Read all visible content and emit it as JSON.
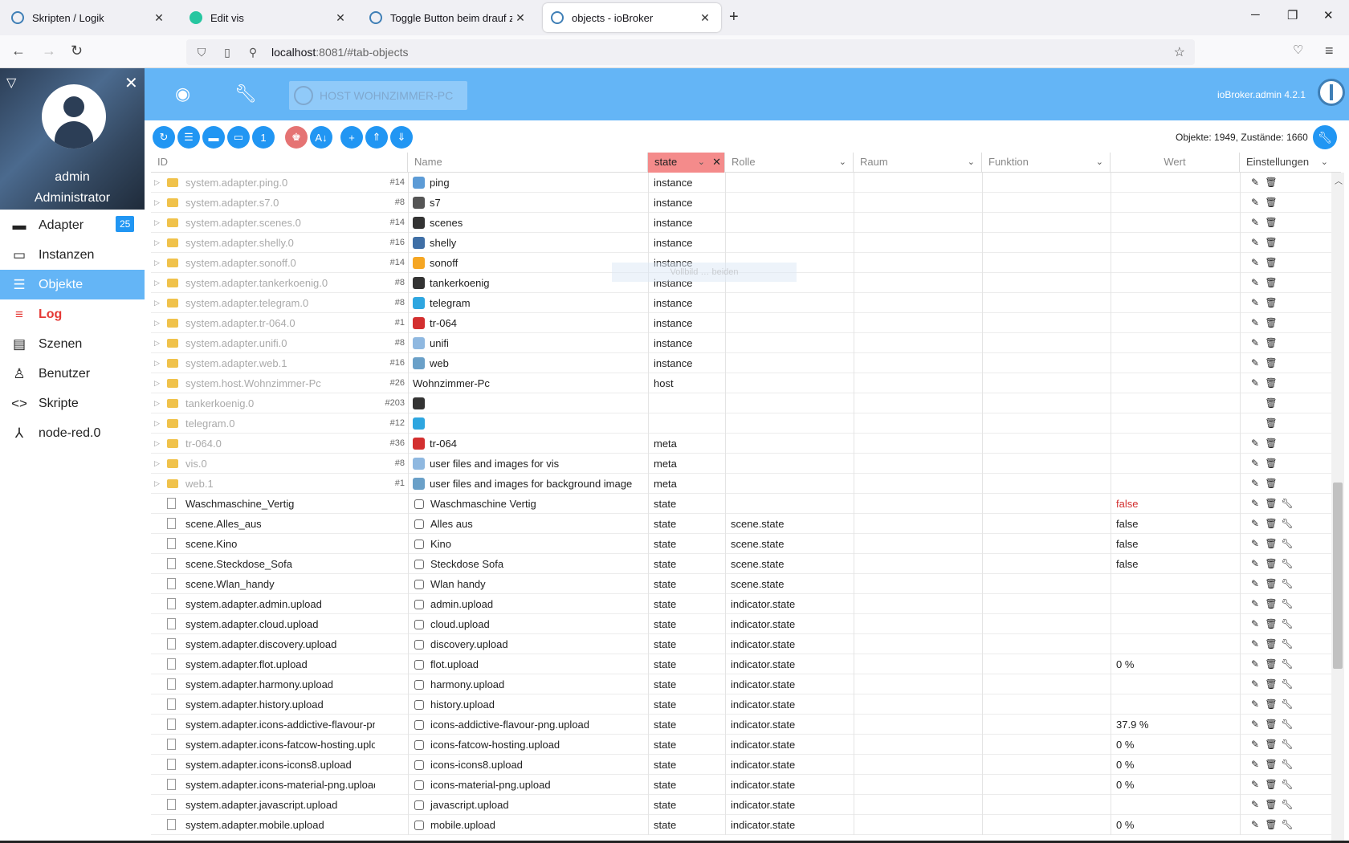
{
  "browser": {
    "tabs": [
      {
        "title": "Skripten / Logik",
        "favicon_color": "#3f7fb6",
        "active": false
      },
      {
        "title": "Edit vis",
        "favicon_color": "#26c6a0",
        "active": false
      },
      {
        "title": "Toggle Button beim drauf zeigen",
        "favicon_color": "#3f7fb6",
        "active": false
      },
      {
        "title": "objects - ioBroker",
        "favicon_color": "#3f7fb6",
        "active": true
      }
    ],
    "url_host": "localhost",
    "url_path": ":8081/#tab-objects"
  },
  "sidebar": {
    "user_name": "admin",
    "user_role": "Administrator",
    "items": [
      {
        "label": "Adapter",
        "icon": "store-icon",
        "glyph": "▬",
        "badge": "25"
      },
      {
        "label": "Instanzen",
        "icon": "instances-icon",
        "glyph": "▭"
      },
      {
        "label": "Objekte",
        "icon": "list-icon",
        "glyph": "☰",
        "active": true
      },
      {
        "label": "Log",
        "icon": "log-icon",
        "glyph": "≡"
      },
      {
        "label": "Szenen",
        "icon": "scenes-icon",
        "glyph": "▤"
      },
      {
        "label": "Benutzer",
        "icon": "user-icon",
        "glyph": "♙"
      },
      {
        "label": "Skripte",
        "icon": "code-icon",
        "glyph": "<>"
      },
      {
        "label": "node-red.0",
        "icon": "node-red-icon",
        "glyph": "⅄"
      }
    ]
  },
  "appbar": {
    "host_label": "HOST WOHNZIMMER-PC",
    "version": "ioBroker.admin 4.2.1"
  },
  "toolbar": {
    "counts": "Objekte: 1949, Zustände: 1660"
  },
  "columns": {
    "id": "ID",
    "name": "Name",
    "type_filter": "state",
    "role": "Rolle",
    "room": "Raum",
    "function": "Funktion",
    "value": "Wert",
    "settings": "Einstellungen"
  },
  "ghost_tooltip": "Vollbild … beiden",
  "colors": {
    "accent": "#64b5f6",
    "button": "#2196f3",
    "filter": "#f48b8b",
    "log_red": "#e53935"
  },
  "rows": [
    {
      "id": "system.adapter.ping.0",
      "count": "#14",
      "name": "ping",
      "icon_color": "#5c9bd6",
      "type": "instance",
      "role": "",
      "value": "",
      "kind": "folder",
      "actions": "ed"
    },
    {
      "id": "system.adapter.s7.0",
      "count": "#8",
      "name": "s7",
      "icon_color": "#555555",
      "type": "instance",
      "role": "",
      "value": "",
      "kind": "folder",
      "actions": "ed"
    },
    {
      "id": "system.adapter.scenes.0",
      "count": "#14",
      "name": "scenes",
      "icon_color": "#333333",
      "type": "instance",
      "role": "",
      "value": "",
      "kind": "folder",
      "actions": "ed"
    },
    {
      "id": "system.adapter.shelly.0",
      "count": "#16",
      "name": "shelly",
      "icon_color": "#3f6fa6",
      "type": "instance",
      "role": "",
      "value": "",
      "kind": "folder",
      "actions": "ed"
    },
    {
      "id": "system.adapter.sonoff.0",
      "count": "#14",
      "name": "sonoff",
      "icon_color": "#f5a623",
      "type": "instance",
      "role": "",
      "value": "",
      "kind": "folder",
      "actions": "ed"
    },
    {
      "id": "system.adapter.tankerkoenig.0",
      "count": "#8",
      "name": "tankerkoenig",
      "icon_color": "#333333",
      "type": "instance",
      "role": "",
      "value": "",
      "kind": "folder",
      "actions": "ed"
    },
    {
      "id": "system.adapter.telegram.0",
      "count": "#8",
      "name": "telegram",
      "icon_color": "#2ea6e0",
      "type": "instance",
      "role": "",
      "value": "",
      "kind": "folder",
      "actions": "ed"
    },
    {
      "id": "system.adapter.tr-064.0",
      "count": "#1",
      "name": "tr-064",
      "icon_color": "#d32f2f",
      "type": "instance",
      "role": "",
      "value": "",
      "kind": "folder",
      "actions": "ed"
    },
    {
      "id": "system.adapter.unifi.0",
      "count": "#8",
      "name": "unifi",
      "icon_color": "#8fb8e0",
      "type": "instance",
      "role": "",
      "value": "",
      "kind": "folder",
      "actions": "ed"
    },
    {
      "id": "system.adapter.web.1",
      "count": "#16",
      "name": "web",
      "icon_color": "#6aa0c8",
      "type": "instance",
      "role": "",
      "value": "",
      "kind": "folder",
      "actions": "ed"
    },
    {
      "id": "system.host.Wohnzimmer-Pc",
      "count": "#26",
      "name": "Wohnzimmer-Pc",
      "icon_color": "",
      "type": "host",
      "role": "",
      "value": "",
      "kind": "folder",
      "actions": "ed"
    },
    {
      "id": "tankerkoenig.0",
      "count": "#203",
      "name": "",
      "icon_color": "#333333",
      "type": "",
      "role": "",
      "value": "",
      "kind": "folder",
      "actions": "d"
    },
    {
      "id": "telegram.0",
      "count": "#12",
      "name": "",
      "icon_color": "#2ea6e0",
      "type": "",
      "role": "",
      "value": "",
      "kind": "folder",
      "actions": "d"
    },
    {
      "id": "tr-064.0",
      "count": "#36",
      "name": "tr-064",
      "icon_color": "#d32f2f",
      "type": "meta",
      "role": "",
      "value": "",
      "kind": "folder",
      "actions": "ed"
    },
    {
      "id": "vis.0",
      "count": "#8",
      "name": "user files and images for vis",
      "icon_color": "#8fb8e0",
      "type": "meta",
      "role": "",
      "value": "",
      "kind": "folder",
      "actions": "ed"
    },
    {
      "id": "web.1",
      "count": "#1",
      "name": "user files and images for background image",
      "icon_color": "#6aa0c8",
      "type": "meta",
      "role": "",
      "value": "",
      "kind": "folder",
      "actions": "ed"
    },
    {
      "id": "Waschmaschine_Vertig",
      "count": "",
      "name": "Waschmaschine Vertig",
      "icon_color": "state",
      "type": "state",
      "role": "",
      "value": "false",
      "value_red": true,
      "kind": "file",
      "actions": "edw"
    },
    {
      "id": "scene.Alles_aus",
      "count": "",
      "name": "Alles aus",
      "icon_color": "state",
      "type": "state",
      "role": "scene.state",
      "value": "false",
      "kind": "file",
      "actions": "edw"
    },
    {
      "id": "scene.Kino",
      "count": "",
      "name": "Kino",
      "icon_color": "state",
      "type": "state",
      "role": "scene.state",
      "value": "false",
      "kind": "file",
      "actions": "edw"
    },
    {
      "id": "scene.Steckdose_Sofa",
      "count": "",
      "name": "Steckdose Sofa",
      "icon_color": "state",
      "type": "state",
      "role": "scene.state",
      "value": "false",
      "kind": "file",
      "actions": "edw"
    },
    {
      "id": "scene.Wlan_handy",
      "count": "",
      "name": "Wlan handy",
      "icon_color": "state",
      "type": "state",
      "role": "scene.state",
      "value": "",
      "kind": "file",
      "actions": "edw"
    },
    {
      "id": "system.adapter.admin.upload",
      "count": "",
      "name": "admin.upload",
      "icon_color": "state",
      "type": "state",
      "role": "indicator.state",
      "value": "",
      "kind": "file",
      "actions": "edw"
    },
    {
      "id": "system.adapter.cloud.upload",
      "count": "",
      "name": "cloud.upload",
      "icon_color": "state",
      "type": "state",
      "role": "indicator.state",
      "value": "",
      "kind": "file",
      "actions": "edw"
    },
    {
      "id": "system.adapter.discovery.upload",
      "count": "",
      "name": "discovery.upload",
      "icon_color": "state",
      "type": "state",
      "role": "indicator.state",
      "value": "",
      "kind": "file",
      "actions": "edw"
    },
    {
      "id": "system.adapter.flot.upload",
      "count": "",
      "name": "flot.upload",
      "icon_color": "state",
      "type": "state",
      "role": "indicator.state",
      "value": "0 %",
      "kind": "file",
      "actions": "edw"
    },
    {
      "id": "system.adapter.harmony.upload",
      "count": "",
      "name": "harmony.upload",
      "icon_color": "state",
      "type": "state",
      "role": "indicator.state",
      "value": "",
      "kind": "file",
      "actions": "edw"
    },
    {
      "id": "system.adapter.history.upload",
      "count": "",
      "name": "history.upload",
      "icon_color": "state",
      "type": "state",
      "role": "indicator.state",
      "value": "",
      "kind": "file",
      "actions": "edw"
    },
    {
      "id": "system.adapter.icons-addictive-flavour-png.upload",
      "count": "",
      "name": "icons-addictive-flavour-png.upload",
      "icon_color": "state",
      "type": "state",
      "role": "indicator.state",
      "value": "37.9 %",
      "kind": "file",
      "actions": "edw"
    },
    {
      "id": "system.adapter.icons-fatcow-hosting.upload",
      "count": "",
      "name": "icons-fatcow-hosting.upload",
      "icon_color": "state",
      "type": "state",
      "role": "indicator.state",
      "value": "0 %",
      "kind": "file",
      "actions": "edw"
    },
    {
      "id": "system.adapter.icons-icons8.upload",
      "count": "",
      "name": "icons-icons8.upload",
      "icon_color": "state",
      "type": "state",
      "role": "indicator.state",
      "value": "0 %",
      "kind": "file",
      "actions": "edw"
    },
    {
      "id": "system.adapter.icons-material-png.upload",
      "count": "",
      "name": "icons-material-png.upload",
      "icon_color": "state",
      "type": "state",
      "role": "indicator.state",
      "value": "0 %",
      "kind": "file",
      "actions": "edw"
    },
    {
      "id": "system.adapter.javascript.upload",
      "count": "",
      "name": "javascript.upload",
      "icon_color": "state",
      "type": "state",
      "role": "indicator.state",
      "value": "",
      "kind": "file",
      "actions": "edw"
    },
    {
      "id": "system.adapter.mobile.upload",
      "count": "",
      "name": "mobile.upload",
      "icon_color": "state",
      "type": "state",
      "role": "indicator.state",
      "value": "0 %",
      "kind": "file",
      "actions": "edw"
    }
  ]
}
